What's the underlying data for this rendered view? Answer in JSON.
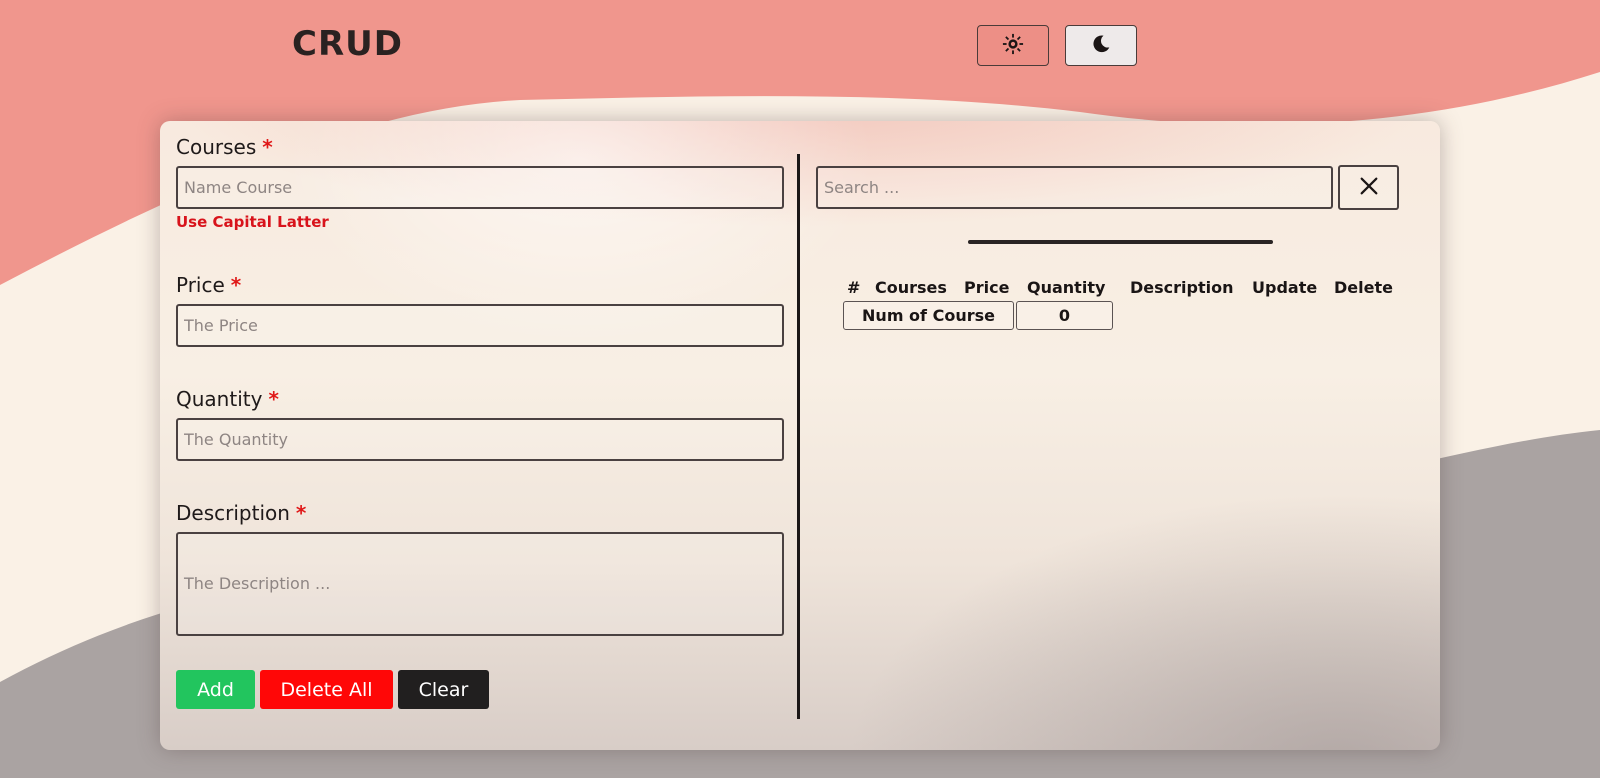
{
  "header": {
    "title": "CRUD",
    "light_mode_icon": "sun-icon",
    "dark_mode_icon": "moon-icon"
  },
  "form": {
    "courses": {
      "label": "Courses",
      "required_mark": "*",
      "placeholder": "Name Course",
      "value": "",
      "hint": "Use Capital Latter"
    },
    "price": {
      "label": "Price",
      "required_mark": "*",
      "placeholder": "The Price",
      "value": ""
    },
    "quantity": {
      "label": "Quantity",
      "required_mark": "*",
      "placeholder": "The Quantity",
      "value": ""
    },
    "description": {
      "label": "Description",
      "required_mark": "*",
      "placeholder": "The Description ...",
      "value": ""
    },
    "buttons": {
      "add": "Add",
      "delete_all": "Delete All",
      "clear": "Clear"
    }
  },
  "search": {
    "placeholder": "Search ...",
    "value": "",
    "clear_icon": "close-icon"
  },
  "table": {
    "headers": [
      "#",
      "Courses",
      "Price",
      "Quantity",
      "Description",
      "Update",
      "Delete"
    ],
    "count_label": "Num of Course",
    "count_value": "0"
  },
  "colors": {
    "top_wave": "#f0968d",
    "cream": "#faf1e6",
    "bottom_wave": "#aaa3a2",
    "add_button": "#22c55e",
    "delete_all_button": "#ff0707",
    "clear_button": "#211f1f",
    "required_mark": "#e01818",
    "hint_text": "#d8131b"
  }
}
